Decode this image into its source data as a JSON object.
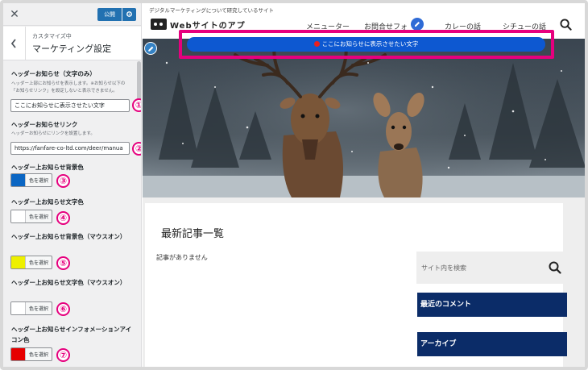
{
  "customizer": {
    "close_glyph": "✕",
    "publish_label": "公開",
    "breadcrumb": "カスタマイズ中",
    "section_title": "マーケティング設定",
    "fields": [
      {
        "label": "ヘッダーお知らせ（文字のみ）",
        "description": "ヘッダー上部にお知らせを表示します。※お知らせ以下の「お知らせリンク」を設定しないと表示できません。",
        "value": "ここにお知らせに表示させたい文字",
        "marker": "①"
      },
      {
        "label": "ヘッダーお知らせリンク",
        "description": "ヘッダーお知らせにリンクを設置します。",
        "value": "https://fanfare-co-ltd.com/deer/manua",
        "marker": "②"
      },
      {
        "label": "ヘッダー上お知らせ背景色",
        "color": "#0b66c3",
        "button": "色を選択",
        "marker": "③"
      },
      {
        "label": "ヘッダー上お知らせ文字色",
        "color": "#ffffff",
        "button": "色を選択",
        "marker": "④"
      },
      {
        "label": "ヘッダー上お知らせ背景色（マウスオン）",
        "color": "#eef000",
        "button": "色を選択",
        "marker": "⑤"
      },
      {
        "label": "ヘッダー上お知らせ文字色（マウスオン）",
        "color": "#ffffff",
        "button": "色を選択",
        "marker": "⑥"
      },
      {
        "label": "ヘッダー上お知らせインフォメーションアイコン色",
        "color": "#e60000",
        "button": "色を選択",
        "marker": "⑦"
      }
    ]
  },
  "site": {
    "tagline": "デジタルマーケティングについて研究しているサイト",
    "name": "Webサイトのアプ",
    "nav": [
      "メニューター",
      "お問合せフォ",
      "カレーの話",
      "シチューの話"
    ],
    "notice_text": "ここにお知らせに表示させたい文字",
    "latest_heading": "最新記事一覧",
    "no_posts": "記事がありません",
    "search_placeholder": "サイト内を検索",
    "widgets": [
      "最近のコメント",
      "アーカイブ"
    ]
  },
  "colors": {
    "accent_highlight": "#e6007e",
    "notice_bg": "#0d58d1",
    "widget_bg": "#0b2c68",
    "wp_blue": "#2271b1"
  }
}
